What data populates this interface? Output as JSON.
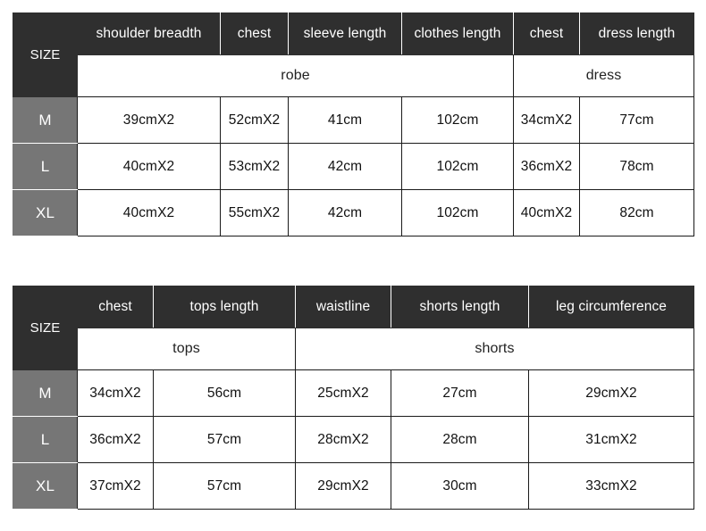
{
  "tables": [
    {
      "id": "robe-dress",
      "size_label": "SIZE",
      "columns": [
        "shoulder breadth",
        "chest",
        "sleeve length",
        "clothes length",
        "chest",
        "dress length"
      ],
      "groups": [
        {
          "label": "robe",
          "span": 4
        },
        {
          "label": "dress",
          "span": 2
        }
      ],
      "rows": [
        {
          "size": "M",
          "values": [
            "39cmX2",
            "52cmX2",
            "41cm",
            "102cm",
            "34cmX2",
            "77cm"
          ]
        },
        {
          "size": "L",
          "values": [
            "40cmX2",
            "53cmX2",
            "42cm",
            "102cm",
            "36cmX2",
            "78cm"
          ]
        },
        {
          "size": "XL",
          "values": [
            "40cmX2",
            "55cmX2",
            "42cm",
            "102cm",
            "40cmX2",
            "82cm"
          ]
        }
      ]
    },
    {
      "id": "tops-shorts",
      "size_label": "SIZE",
      "columns": [
        "chest",
        "tops length",
        "waistline",
        "shorts length",
        "leg circumference"
      ],
      "groups": [
        {
          "label": "tops",
          "span": 2
        },
        {
          "label": "shorts",
          "span": 3
        }
      ],
      "rows": [
        {
          "size": "M",
          "values": [
            "34cmX2",
            "56cm",
            "25cmX2",
            "27cm",
            "29cmX2"
          ]
        },
        {
          "size": "L",
          "values": [
            "36cmX2",
            "57cm",
            "28cmX2",
            "28cm",
            "31cmX2"
          ]
        },
        {
          "size": "XL",
          "values": [
            "37cmX2",
            "57cm",
            "29cmX2",
            "30cm",
            "33cmX2"
          ]
        }
      ]
    }
  ],
  "colors": {
    "header_dark": "#2f2f2f",
    "size_gray": "#767676",
    "cell_background": "#ffffff",
    "border": "#1a1a1a",
    "text_light": "#ffffff",
    "text_dark": "#111111"
  }
}
